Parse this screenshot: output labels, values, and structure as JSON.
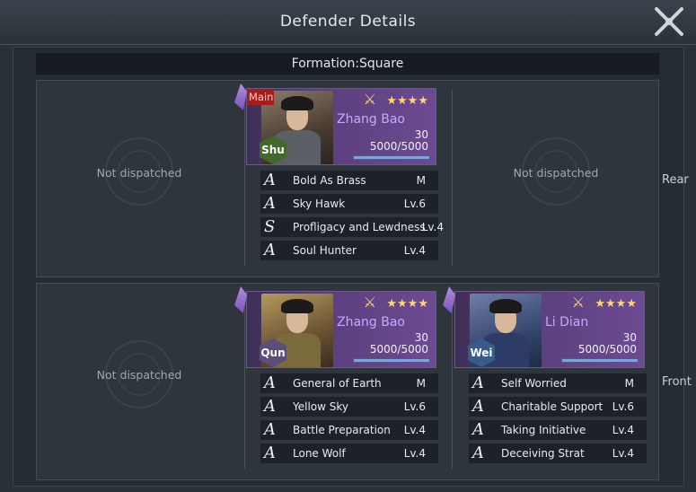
{
  "window": {
    "title": "Defender Details",
    "close_icon": "close-icon"
  },
  "formation": {
    "label": "Formation:Square"
  },
  "rows": {
    "rear": {
      "label": "Rear",
      "empty_left": "Not dispatched",
      "empty_right": "Not dispatched",
      "general": {
        "tag": "Main",
        "name": "Zhang Bao",
        "stars": "★★★★",
        "level": "30",
        "troops": "5000/5000",
        "troops_fraction": 1.0,
        "faction": "Shu",
        "skills": [
          {
            "grade": "A",
            "name": "Bold As Brass",
            "level": "M"
          },
          {
            "grade": "A",
            "name": "Sky Hawk",
            "level": "Lv.6"
          },
          {
            "grade": "S",
            "name": "Profligacy and Lewdness",
            "level": "Lv.4"
          },
          {
            "grade": "A",
            "name": "Soul Hunter",
            "level": "Lv.4"
          }
        ]
      }
    },
    "front": {
      "label": "Front",
      "empty_left": "Not dispatched",
      "generals": [
        {
          "name": "Zhang Bao",
          "stars": "★★★★",
          "level": "30",
          "troops": "5000/5000",
          "troops_fraction": 1.0,
          "faction": "Qun",
          "skills": [
            {
              "grade": "A",
              "name": "General of Earth",
              "level": "M"
            },
            {
              "grade": "A",
              "name": "Yellow Sky",
              "level": "Lv.6"
            },
            {
              "grade": "A",
              "name": "Battle Preparation",
              "level": "Lv.4"
            },
            {
              "grade": "A",
              "name": "Lone Wolf",
              "level": "Lv.4"
            }
          ]
        },
        {
          "name": "Li Dian",
          "stars": "★★★★",
          "level": "30",
          "troops": "5000/5000",
          "troops_fraction": 1.0,
          "faction": "Wei",
          "skills": [
            {
              "grade": "A",
              "name": "Self Worried",
              "level": "M"
            },
            {
              "grade": "A",
              "name": "Charitable Support",
              "level": "Lv.6"
            },
            {
              "grade": "A",
              "name": "Taking Initiative",
              "level": "Lv.4"
            },
            {
              "grade": "A",
              "name": "Deceiving Strat",
              "level": "Lv.4"
            }
          ]
        }
      ]
    }
  },
  "colors": {
    "background": "#2a3038",
    "card_purple": "#5b3f7d",
    "name_purple": "#c9a7ff",
    "star_gold": "#ffd66b",
    "main_tag_red": "#a61d1d",
    "shu_green": "#3f6a2c",
    "qun_purple": "#5d4d7a",
    "wei_blue": "#385c8a"
  }
}
